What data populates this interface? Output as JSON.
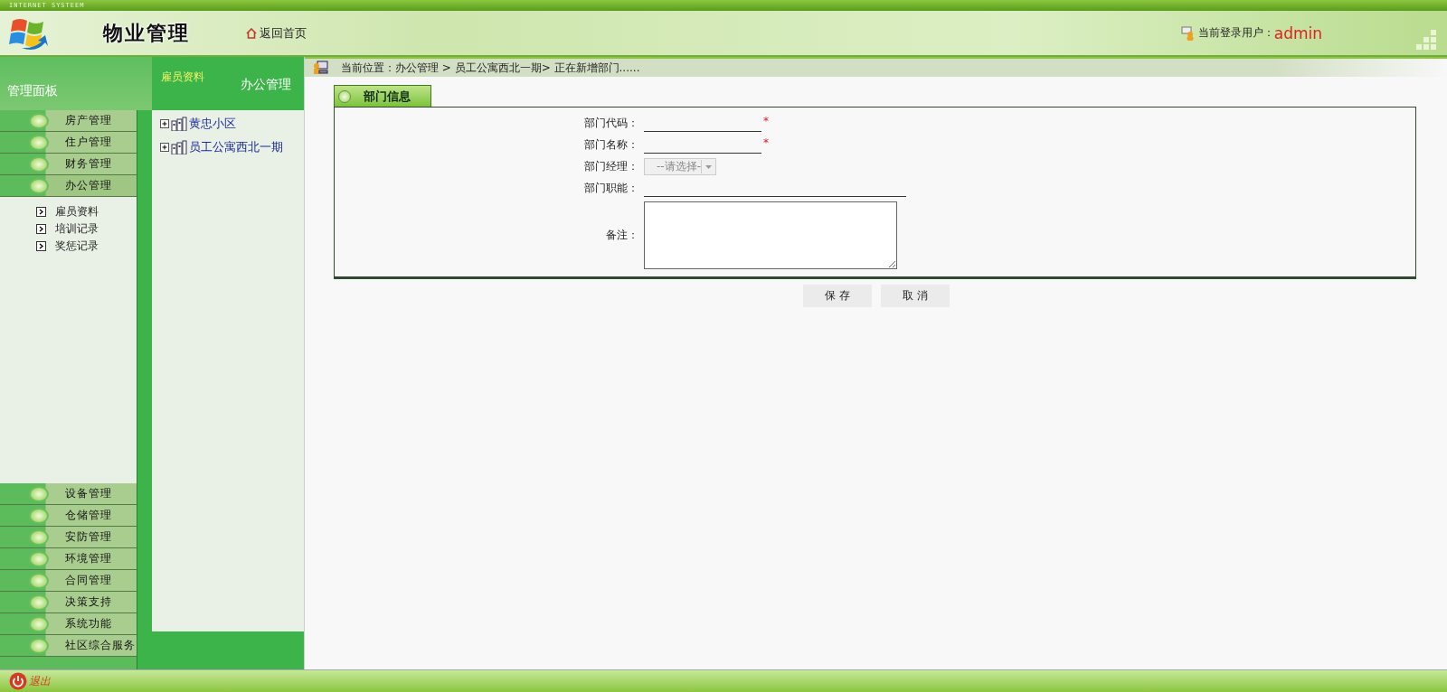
{
  "top_strip": {
    "text": "INTERNET SYSTEEM"
  },
  "header": {
    "title": "物业管理",
    "home_link": "返回首页",
    "user_label": "当前登录用户：",
    "user": "admin"
  },
  "sidebar": {
    "title": "管理面板",
    "menu_top": [
      {
        "label": "房产管理",
        "expanded": false
      },
      {
        "label": "住户管理",
        "expanded": false
      },
      {
        "label": "财务管理",
        "expanded": false
      },
      {
        "label": "办公管理",
        "expanded": true,
        "children": [
          {
            "label": "雇员资料"
          },
          {
            "label": "培训记录"
          },
          {
            "label": "奖惩记录"
          }
        ]
      }
    ],
    "menu_bottom": [
      {
        "label": "设备管理"
      },
      {
        "label": "仓储管理"
      },
      {
        "label": "安防管理"
      },
      {
        "label": "环境管理"
      },
      {
        "label": "合同管理"
      },
      {
        "label": "决策支持"
      },
      {
        "label": "系统功能"
      },
      {
        "label": "社区综合服务"
      }
    ],
    "logout": "退出"
  },
  "tree_panel": {
    "tab": "雇员资料",
    "title": "办公管理",
    "nodes": [
      {
        "label": "黄忠小区",
        "expanded": false
      },
      {
        "label": "员工公寓西北一期",
        "expanded": false
      }
    ]
  },
  "breadcrumb": "当前位置：办公管理 > 员工公寓西北一期> 正在新增部门......",
  "form": {
    "tab": "部门信息",
    "fields": [
      {
        "kind": "text",
        "label": "部门代码：",
        "mark": "*"
      },
      {
        "kind": "text",
        "label": "部门名称：",
        "mark": "*"
      },
      {
        "kind": "select",
        "label": "部门经理：",
        "value": "--请选择-",
        "disabled": true
      },
      {
        "kind": "wide",
        "label": "部门职能："
      },
      {
        "kind": "textarea",
        "label": "备注："
      }
    ]
  },
  "buttons": [
    "保 存",
    "取 消"
  ]
}
